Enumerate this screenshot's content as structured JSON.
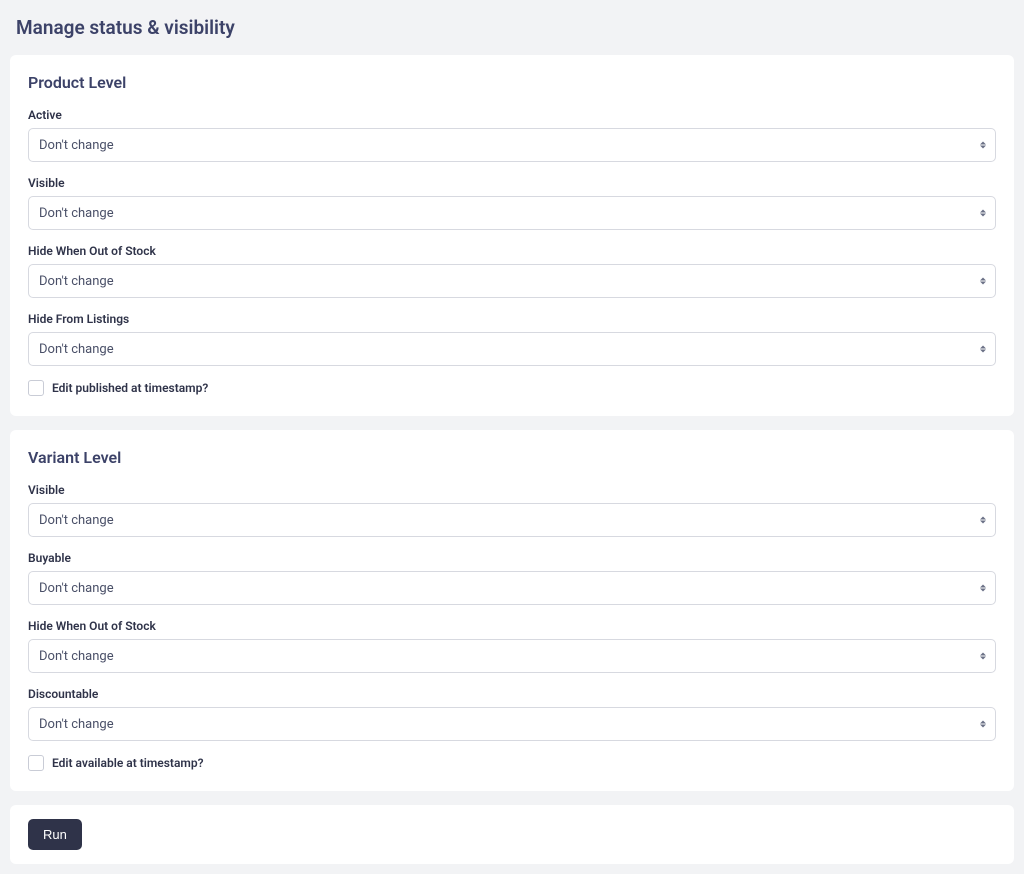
{
  "page_title": "Manage status & visibility",
  "default_select_value": "Don't change",
  "product_level": {
    "title": "Product Level",
    "fields": {
      "active": {
        "label": "Active",
        "value": "Don't change"
      },
      "visible": {
        "label": "Visible",
        "value": "Don't change"
      },
      "hide_oos": {
        "label": "Hide When Out of Stock",
        "value": "Don't change"
      },
      "hide_listings": {
        "label": "Hide From Listings",
        "value": "Don't change"
      }
    },
    "checkbox": {
      "label": "Edit published at timestamp?",
      "checked": false
    }
  },
  "variant_level": {
    "title": "Variant Level",
    "fields": {
      "visible": {
        "label": "Visible",
        "value": "Don't change"
      },
      "buyable": {
        "label": "Buyable",
        "value": "Don't change"
      },
      "hide_oos": {
        "label": "Hide When Out of Stock",
        "value": "Don't change"
      },
      "discountable": {
        "label": "Discountable",
        "value": "Don't change"
      }
    },
    "checkbox": {
      "label": "Edit available at timestamp?",
      "checked": false
    }
  },
  "actions": {
    "run_label": "Run"
  }
}
